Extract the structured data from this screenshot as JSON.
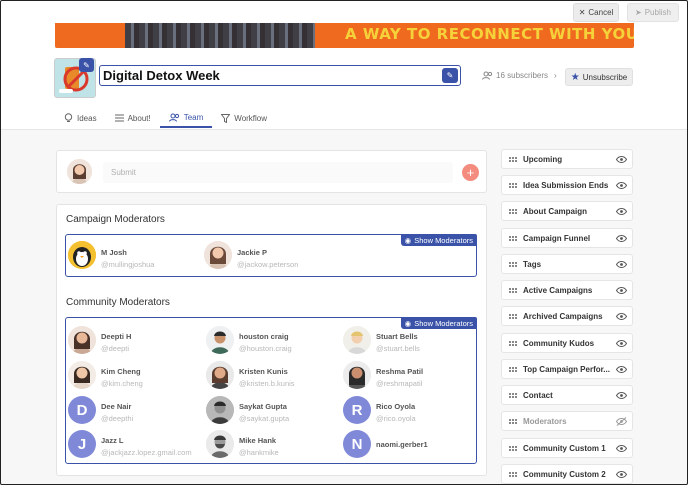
{
  "topbar": {
    "cancel_label": "Cancel",
    "publish_label": "Publish"
  },
  "banner": {
    "text": "A WAY TO RECONNECT WITH YOURSELF"
  },
  "campaign": {
    "title": "Digital Detox Week",
    "subscribers": "16 subscribers",
    "unsubscribe_label": "Unsubscribe"
  },
  "tabs": [
    {
      "label": "Ideas",
      "icon": "bulb-icon"
    },
    {
      "label": "About!",
      "icon": "list-icon"
    },
    {
      "label": "Team",
      "icon": "users-icon",
      "active": true
    },
    {
      "label": "Workflow",
      "icon": "filter-icon"
    }
  ],
  "submit": {
    "placeholder": "Submit"
  },
  "campaign_moderators": {
    "title": "Campaign Moderators",
    "show_label": "Show Moderators",
    "members": [
      {
        "name": "M Josh",
        "handle": "@mullingjoshua",
        "avatar": "penguin"
      },
      {
        "name": "Jackie P",
        "handle": "@jackow.peterson",
        "avatar": "photo"
      }
    ]
  },
  "community_moderators": {
    "title": "Community Moderators",
    "show_label": "Show Moderators",
    "members": [
      {
        "name": "Deepti H",
        "handle": "@deepti",
        "avatar": "photo"
      },
      {
        "name": "houston craig",
        "handle": "@houston.craig",
        "avatar": "photo"
      },
      {
        "name": "Stuart Bells",
        "handle": "@stuart.bells",
        "avatar": "photo"
      },
      {
        "name": "Kim Cheng",
        "handle": "@kim.cheng",
        "avatar": "photo"
      },
      {
        "name": "Kristen Kunis",
        "handle": "@kristen.b.kunis",
        "avatar": "photo"
      },
      {
        "name": "Reshma Patil",
        "handle": "@reshmapatil",
        "avatar": "photo"
      },
      {
        "name": "Dee Nair",
        "handle": "@deepthi",
        "avatar": "D"
      },
      {
        "name": "Saykat Gupta",
        "handle": "@saykat.gupta",
        "avatar": "photo"
      },
      {
        "name": "Rico Oyola",
        "handle": "@rico.oyola",
        "avatar": "R"
      },
      {
        "name": "Jazz L",
        "handle": "@jackjazz.lopez.gmail.com",
        "avatar": "J"
      },
      {
        "name": "Mike Hank",
        "handle": "@hankmike",
        "avatar": "photo"
      },
      {
        "name": "naomi.gerber1",
        "handle": "",
        "avatar": "N"
      }
    ]
  },
  "sidebar": {
    "items": [
      {
        "label": "Upcoming",
        "visible": true
      },
      {
        "label": "Idea Submission Ends",
        "visible": true
      },
      {
        "label": "About Campaign",
        "visible": true
      },
      {
        "label": "Campaign Funnel",
        "visible": true
      },
      {
        "label": "Tags",
        "visible": true
      },
      {
        "label": "Active Campaigns",
        "visible": true
      },
      {
        "label": "Archived Campaigns",
        "visible": true
      },
      {
        "label": "Community Kudos",
        "visible": true
      },
      {
        "label": "Top Campaign Perfor...",
        "visible": true
      },
      {
        "label": "Contact",
        "visible": true
      },
      {
        "label": "Moderators",
        "visible": false
      },
      {
        "label": "Community Custom 1",
        "visible": true
      },
      {
        "label": "Community Custom 2",
        "visible": true
      }
    ]
  },
  "colors": {
    "accent": "#3a53a8",
    "banner": "#ef6a1f",
    "letter_avatar": "#7f89d8",
    "add": "#f38c7e"
  }
}
